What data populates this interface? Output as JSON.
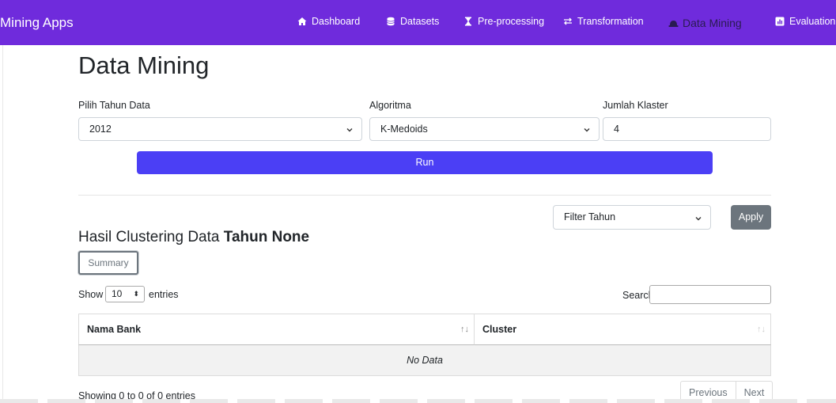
{
  "navbar": {
    "brand": "Mining Apps",
    "items": [
      {
        "label": "Dashboard",
        "icon": "home-icon"
      },
      {
        "label": "Datasets",
        "icon": "database-icon"
      },
      {
        "label": "Pre-processing",
        "icon": "hourglass-icon"
      },
      {
        "label": "Transformation",
        "icon": "swap-arrows-icon"
      },
      {
        "label": "Data Mining",
        "icon": "hard-hat-icon",
        "active": true
      },
      {
        "label": "Evaluation",
        "icon": "chart-box-icon"
      }
    ],
    "color": "#6f2bdc"
  },
  "page": {
    "title": "Data Mining"
  },
  "form": {
    "year_label": "Pilih Tahun Data",
    "year_value": "2012",
    "algorithm_label": "Algoritma",
    "algorithm_value": "K-Medoids",
    "clusters_label": "Jumlah Klaster",
    "clusters_value": "4",
    "run_label": "Run",
    "run_color": "#4b3ff5"
  },
  "filter": {
    "select_value": "Filter Tahun",
    "apply_label": "Apply"
  },
  "results": {
    "title_prefix": "Hasil Clustering Data ",
    "title_bold": "Tahun None",
    "summary_label": "Summary"
  },
  "datatable": {
    "show_label": "Show",
    "length_value": "10",
    "entries_label": "entries",
    "search_label": "Search:",
    "columns": [
      "Nama Bank",
      "Cluster"
    ],
    "empty_text": "No Data",
    "info": "Showing 0 to 0 of 0 entries",
    "prev_label": "Previous",
    "next_label": "Next"
  }
}
